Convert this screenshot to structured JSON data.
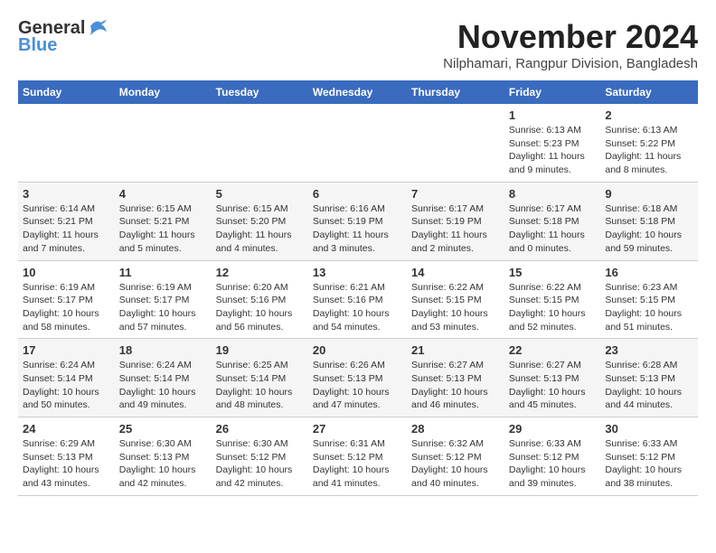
{
  "logo": {
    "general": "General",
    "blue": "Blue"
  },
  "title": "November 2024",
  "subtitle": "Nilphamari, Rangpur Division, Bangladesh",
  "headers": [
    "Sunday",
    "Monday",
    "Tuesday",
    "Wednesday",
    "Thursday",
    "Friday",
    "Saturday"
  ],
  "weeks": [
    [
      {
        "day": "",
        "info": ""
      },
      {
        "day": "",
        "info": ""
      },
      {
        "day": "",
        "info": ""
      },
      {
        "day": "",
        "info": ""
      },
      {
        "day": "",
        "info": ""
      },
      {
        "day": "1",
        "info": "Sunrise: 6:13 AM\nSunset: 5:23 PM\nDaylight: 11 hours\nand 9 minutes."
      },
      {
        "day": "2",
        "info": "Sunrise: 6:13 AM\nSunset: 5:22 PM\nDaylight: 11 hours\nand 8 minutes."
      }
    ],
    [
      {
        "day": "3",
        "info": "Sunrise: 6:14 AM\nSunset: 5:21 PM\nDaylight: 11 hours\nand 7 minutes."
      },
      {
        "day": "4",
        "info": "Sunrise: 6:15 AM\nSunset: 5:21 PM\nDaylight: 11 hours\nand 5 minutes."
      },
      {
        "day": "5",
        "info": "Sunrise: 6:15 AM\nSunset: 5:20 PM\nDaylight: 11 hours\nand 4 minutes."
      },
      {
        "day": "6",
        "info": "Sunrise: 6:16 AM\nSunset: 5:19 PM\nDaylight: 11 hours\nand 3 minutes."
      },
      {
        "day": "7",
        "info": "Sunrise: 6:17 AM\nSunset: 5:19 PM\nDaylight: 11 hours\nand 2 minutes."
      },
      {
        "day": "8",
        "info": "Sunrise: 6:17 AM\nSunset: 5:18 PM\nDaylight: 11 hours\nand 0 minutes."
      },
      {
        "day": "9",
        "info": "Sunrise: 6:18 AM\nSunset: 5:18 PM\nDaylight: 10 hours\nand 59 minutes."
      }
    ],
    [
      {
        "day": "10",
        "info": "Sunrise: 6:19 AM\nSunset: 5:17 PM\nDaylight: 10 hours\nand 58 minutes."
      },
      {
        "day": "11",
        "info": "Sunrise: 6:19 AM\nSunset: 5:17 PM\nDaylight: 10 hours\nand 57 minutes."
      },
      {
        "day": "12",
        "info": "Sunrise: 6:20 AM\nSunset: 5:16 PM\nDaylight: 10 hours\nand 56 minutes."
      },
      {
        "day": "13",
        "info": "Sunrise: 6:21 AM\nSunset: 5:16 PM\nDaylight: 10 hours\nand 54 minutes."
      },
      {
        "day": "14",
        "info": "Sunrise: 6:22 AM\nSunset: 5:15 PM\nDaylight: 10 hours\nand 53 minutes."
      },
      {
        "day": "15",
        "info": "Sunrise: 6:22 AM\nSunset: 5:15 PM\nDaylight: 10 hours\nand 52 minutes."
      },
      {
        "day": "16",
        "info": "Sunrise: 6:23 AM\nSunset: 5:15 PM\nDaylight: 10 hours\nand 51 minutes."
      }
    ],
    [
      {
        "day": "17",
        "info": "Sunrise: 6:24 AM\nSunset: 5:14 PM\nDaylight: 10 hours\nand 50 minutes."
      },
      {
        "day": "18",
        "info": "Sunrise: 6:24 AM\nSunset: 5:14 PM\nDaylight: 10 hours\nand 49 minutes."
      },
      {
        "day": "19",
        "info": "Sunrise: 6:25 AM\nSunset: 5:14 PM\nDaylight: 10 hours\nand 48 minutes."
      },
      {
        "day": "20",
        "info": "Sunrise: 6:26 AM\nSunset: 5:13 PM\nDaylight: 10 hours\nand 47 minutes."
      },
      {
        "day": "21",
        "info": "Sunrise: 6:27 AM\nSunset: 5:13 PM\nDaylight: 10 hours\nand 46 minutes."
      },
      {
        "day": "22",
        "info": "Sunrise: 6:27 AM\nSunset: 5:13 PM\nDaylight: 10 hours\nand 45 minutes."
      },
      {
        "day": "23",
        "info": "Sunrise: 6:28 AM\nSunset: 5:13 PM\nDaylight: 10 hours\nand 44 minutes."
      }
    ],
    [
      {
        "day": "24",
        "info": "Sunrise: 6:29 AM\nSunset: 5:13 PM\nDaylight: 10 hours\nand 43 minutes."
      },
      {
        "day": "25",
        "info": "Sunrise: 6:30 AM\nSunset: 5:13 PM\nDaylight: 10 hours\nand 42 minutes."
      },
      {
        "day": "26",
        "info": "Sunrise: 6:30 AM\nSunset: 5:12 PM\nDaylight: 10 hours\nand 42 minutes."
      },
      {
        "day": "27",
        "info": "Sunrise: 6:31 AM\nSunset: 5:12 PM\nDaylight: 10 hours\nand 41 minutes."
      },
      {
        "day": "28",
        "info": "Sunrise: 6:32 AM\nSunset: 5:12 PM\nDaylight: 10 hours\nand 40 minutes."
      },
      {
        "day": "29",
        "info": "Sunrise: 6:33 AM\nSunset: 5:12 PM\nDaylight: 10 hours\nand 39 minutes."
      },
      {
        "day": "30",
        "info": "Sunrise: 6:33 AM\nSunset: 5:12 PM\nDaylight: 10 hours\nand 38 minutes."
      }
    ]
  ]
}
